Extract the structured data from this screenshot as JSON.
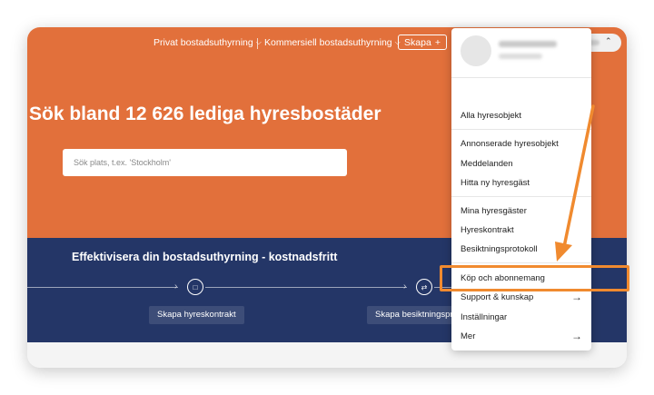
{
  "nav": {
    "private_rentals": "Privat bostadsuthyrning",
    "commercial_rentals": "Kommersiell bostadsuthyrning",
    "create_label": "Skapa"
  },
  "hero": {
    "headline": "Sök bland 12 626 lediga hyresbostäder",
    "search_placeholder": "Sök plats, t.ex. 'Stockholm'"
  },
  "band": {
    "title": "Effektivisera din bostadsuthyrning - kostnadsfritt",
    "step1": "Skapa hyreskontrakt",
    "step2": "Skapa besiktningsprotokoll"
  },
  "menu": {
    "all_listings": "Alla hyresobjekt",
    "advertised": "Annonserade hyresobjekt",
    "messages": "Meddelanden",
    "find_tenant": "Hitta ny hyresgäst",
    "my_tenants": "Mina hyresgäster",
    "lease": "Hyreskontrakt",
    "inspection": "Besiktningsprotokoll",
    "buy_subscribe": "Köp och abonnemang",
    "support": "Support & kunskap",
    "settings": "Inställningar",
    "more": "Mer"
  },
  "colors": {
    "hero": "#e2703b",
    "band": "#243667",
    "highlight": "#f08a2f"
  }
}
